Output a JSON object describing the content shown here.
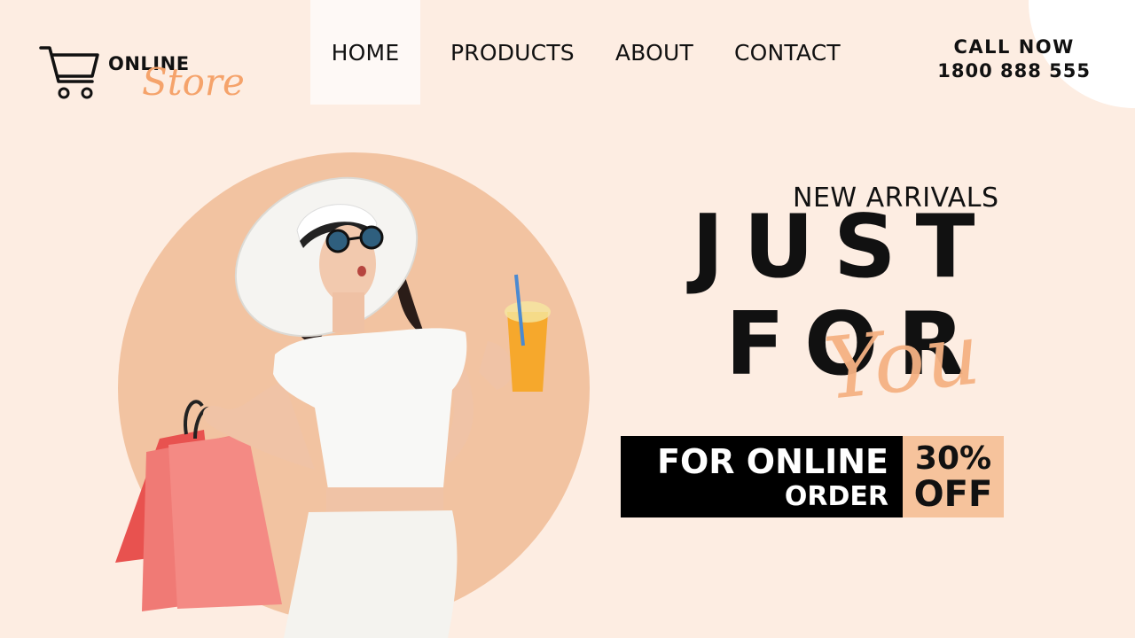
{
  "logo": {
    "line1": "ONLINE",
    "line2": "Store",
    "icon": "shopping-cart-icon"
  },
  "nav": {
    "items": [
      {
        "label": "HOME",
        "active": true
      },
      {
        "label": "PRODUCTS",
        "active": false
      },
      {
        "label": "ABOUT",
        "active": false
      },
      {
        "label": "CONTACT",
        "active": false
      }
    ]
  },
  "contact": {
    "label": "CALL NOW",
    "phone": "1800 888 555"
  },
  "hero": {
    "kicker": "NEW ARRIVALS",
    "headline_line1": "JUST",
    "headline_line2": "FOR",
    "script": "You"
  },
  "offer": {
    "line1": "FOR ONLINE",
    "line2": "ORDER",
    "percent": "30%",
    "off": "OFF"
  },
  "colors": {
    "background": "#fdede2",
    "accent": "#f5a36b",
    "circle": "#f2c3a1",
    "offer_peach": "#f6c39c",
    "dark": "#111111"
  }
}
